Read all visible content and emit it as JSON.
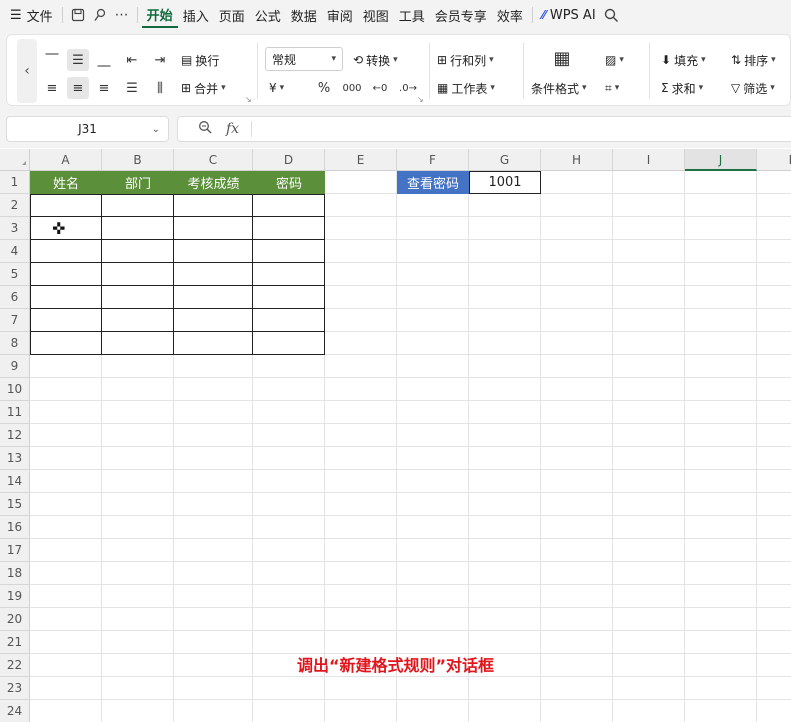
{
  "menubar": {
    "file_label": "文件",
    "tabs": [
      {
        "label": "开始",
        "active": true
      },
      {
        "label": "插入"
      },
      {
        "label": "页面"
      },
      {
        "label": "公式"
      },
      {
        "label": "数据"
      },
      {
        "label": "审阅"
      },
      {
        "label": "视图"
      },
      {
        "label": "工具"
      },
      {
        "label": "会员专享"
      },
      {
        "label": "效率"
      }
    ],
    "ai_label": "WPS AI"
  },
  "ribbon": {
    "wrap_label": "换行",
    "merge_label": "合并",
    "number_format": "常规",
    "convert_label": "转换",
    "rowcol_label": "行和列",
    "sheet_label": "工作表",
    "condfmt_label": "条件格式",
    "fill_label": "填充",
    "sort_label": "排序",
    "sum_label": "求和",
    "filter_label": "筛选",
    "currency_symbol": "¥",
    "percent_symbol": "%",
    "thousands_symbol": "000"
  },
  "formula_bar": {
    "name_box": "J31",
    "fx_label": "fx",
    "formula": ""
  },
  "columns": [
    "A",
    "B",
    "C",
    "D",
    "E",
    "F",
    "G",
    "H",
    "I",
    "J",
    "K"
  ],
  "selected_column": "J",
  "rows": [
    "1",
    "2",
    "3",
    "4",
    "5",
    "6",
    "7",
    "8",
    "9",
    "10",
    "11",
    "12",
    "13",
    "14",
    "15",
    "16",
    "17",
    "18",
    "19",
    "20",
    "21",
    "22",
    "23",
    "24"
  ],
  "table": {
    "headers": [
      "姓名",
      "部门",
      "考核成绩",
      "密码"
    ],
    "header_color": "#5b8f3a"
  },
  "password_lookup": {
    "label": "查看密码",
    "value": "1001",
    "label_color": "#4472c4"
  },
  "caption": "调出“新建格式规则”对话框",
  "caption_color": "#e0161c",
  "accent_color": "#0f6b3f"
}
